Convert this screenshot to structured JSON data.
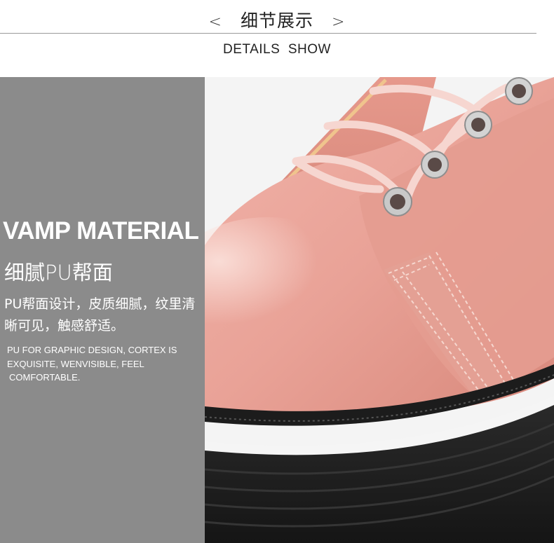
{
  "header": {
    "prev_symbol": "<",
    "title_cn": "细节展示",
    "next_symbol": ">",
    "subtitle_en": "DETAILS  SHOW"
  },
  "panel": {
    "title_en": "VAMP MATERIAL",
    "title_cn": "细腻PU帮面",
    "desc_cn": "PU帮面设计，皮质细腻，纹里清晰可见，触感舒适。",
    "desc_en_line1": "PU FOR GRAPHIC DESIGN, CORTEX IS",
    "desc_en_line2": "EXQUISITE, WENVISIBLE, FEEL",
    "desc_en_line3": "COMFORTABLE.",
    "background_color": "#8b8b8b"
  },
  "photo": {
    "subject": "pink-leather-lace-up-shoe-closeup",
    "upper_color": "#e7a196",
    "sole_color": "#1f1f1f",
    "lace_color": "#f7d8d3"
  }
}
